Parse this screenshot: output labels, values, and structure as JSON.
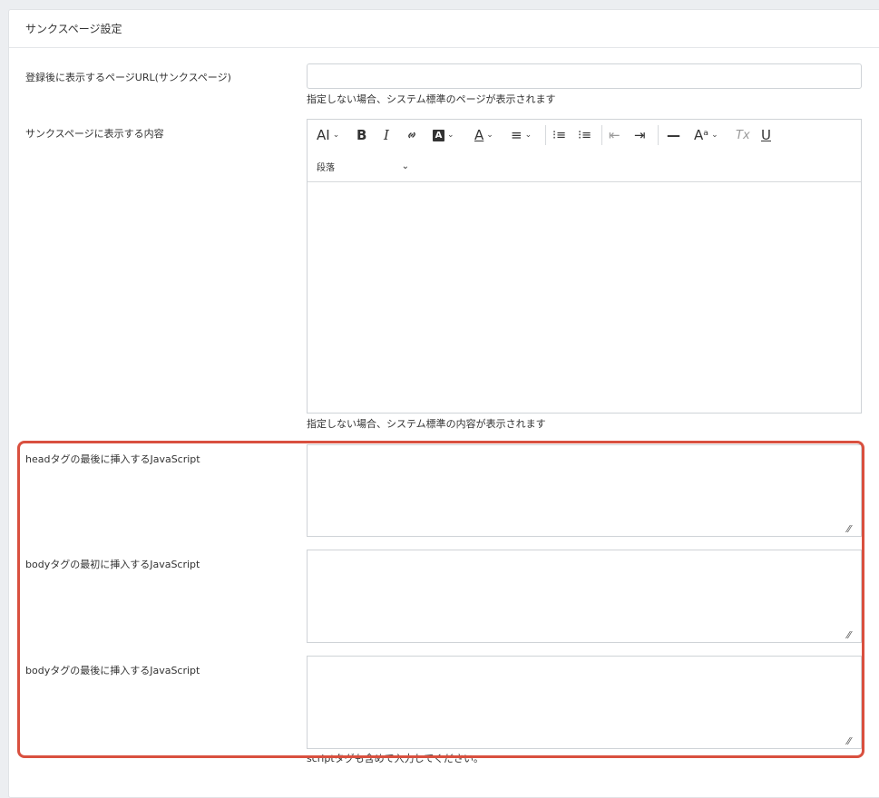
{
  "card": {
    "title": "サンクスページ設定"
  },
  "thanks_url": {
    "label": "登録後に表示するページURL(サンクスページ)",
    "value": "",
    "placeholder": "",
    "help": "指定しない場合、システム標準のページが表示されます"
  },
  "thanks_content": {
    "label": "サンクスページに表示する内容",
    "help": "指定しない場合、システム標準の内容が表示されます",
    "toolbar": {
      "font_size": "AI",
      "bold": "B",
      "italic": "I",
      "link": "🔗",
      "highlight": "A",
      "font_color": "A",
      "align": "≡",
      "bulleted_list": "⁝≡",
      "numbered_list": "⁝≡",
      "outdent": "⇤",
      "indent": "⇥",
      "horizontal_line": "—",
      "special_chars": "Aᵃ",
      "remove_format": "Tx",
      "underline": "U",
      "heading": "段落"
    }
  },
  "head_js": {
    "label": "headタグの最後に挿入するJavaScript",
    "value": ""
  },
  "body_start_js": {
    "label": "bodyタグの最初に挿入するJavaScript",
    "value": ""
  },
  "body_end_js": {
    "label": "bodyタグの最後に挿入するJavaScript",
    "value": "",
    "help": "scriptタグも含めて入力してください。"
  },
  "colors": {
    "highlight_border": "#d9503f",
    "border": "#cfd3d7",
    "background": "#eceef1"
  }
}
